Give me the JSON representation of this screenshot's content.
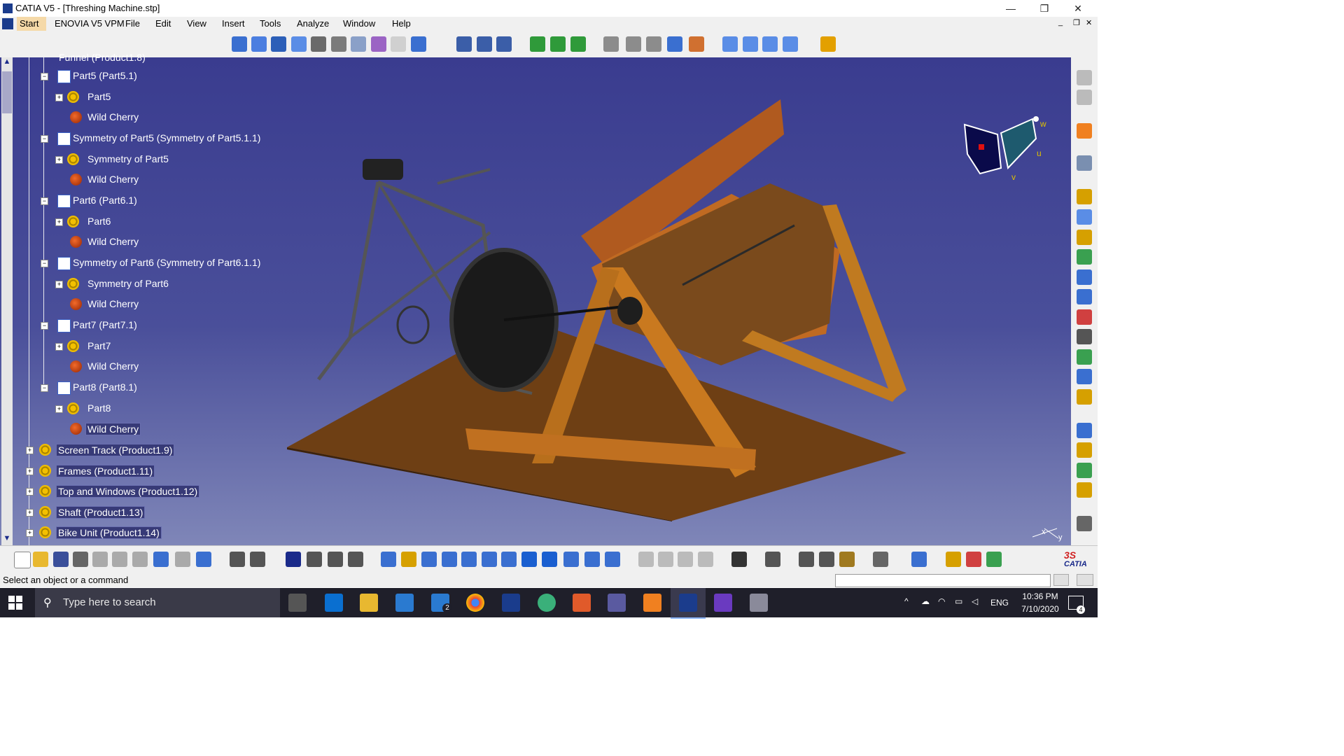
{
  "window": {
    "title": "CATIA V5 - [Threshing Machine.stp]",
    "minimize_glyph": "—",
    "restore_glyph": "❐",
    "close_glyph": "✕",
    "doc_minimize_glyph": "_",
    "doc_restore_glyph": "❐",
    "doc_close_glyph": "✕"
  },
  "menu": {
    "items": [
      "Start",
      "ENOVIA V5 VPM",
      "File",
      "Edit",
      "View",
      "Insert",
      "Tools",
      "Analyze",
      "Window",
      "Help"
    ]
  },
  "tree": {
    "partial_top": "Funnel (Product1.8)",
    "nodes": [
      {
        "label": "Part5 (Part5.1)",
        "level": 1,
        "kind": "product"
      },
      {
        "label": "Part5",
        "level": 2,
        "kind": "part"
      },
      {
        "label": "Wild Cherry",
        "level": 2,
        "kind": "material"
      },
      {
        "label": "Symmetry of Part5 (Symmetry of Part5.1.1)",
        "level": 1,
        "kind": "product"
      },
      {
        "label": "Symmetry of Part5",
        "level": 2,
        "kind": "part"
      },
      {
        "label": "Wild Cherry",
        "level": 2,
        "kind": "material"
      },
      {
        "label": "Part6 (Part6.1)",
        "level": 1,
        "kind": "product"
      },
      {
        "label": "Part6",
        "level": 2,
        "kind": "part"
      },
      {
        "label": "Wild Cherry",
        "level": 2,
        "kind": "material"
      },
      {
        "label": "Symmetry of Part6 (Symmetry of Part6.1.1)",
        "level": 1,
        "kind": "product"
      },
      {
        "label": "Symmetry of Part6",
        "level": 2,
        "kind": "part"
      },
      {
        "label": "Wild Cherry",
        "level": 2,
        "kind": "material"
      },
      {
        "label": "Part7 (Part7.1)",
        "level": 1,
        "kind": "product"
      },
      {
        "label": "Part7",
        "level": 2,
        "kind": "part"
      },
      {
        "label": "Wild Cherry",
        "level": 2,
        "kind": "material"
      },
      {
        "label": "Part8 (Part8.1)",
        "level": 1,
        "kind": "product"
      },
      {
        "label": "Part8",
        "level": 2,
        "kind": "part"
      },
      {
        "label": "Wild Cherry",
        "level": 2,
        "kind": "material"
      },
      {
        "label": "Screen Track (Product1.9)",
        "level": 0,
        "kind": "assembly"
      },
      {
        "label": "Frames (Product1.11)",
        "level": 0,
        "kind": "assembly"
      },
      {
        "label": "Top and Windows (Product1.12)",
        "level": 0,
        "kind": "assembly"
      },
      {
        "label": "Shaft (Product1.13)",
        "level": 0,
        "kind": "assembly"
      },
      {
        "label": "Bike Unit (Product1.14)",
        "level": 0,
        "kind": "assembly"
      }
    ]
  },
  "compass": {
    "axis_u": "u",
    "axis_v": "v",
    "axis_w": "w"
  },
  "axis_triad": {
    "x": "x",
    "y": "y"
  },
  "status": {
    "message": "Select an object or a command",
    "command_input": ""
  },
  "brand": {
    "logo_text": "CATIA"
  },
  "taskbar": {
    "search_placeholder": "Type here to search",
    "time": "10:36 PM",
    "date": "7/10/2020",
    "language": "ENG",
    "mail_badge": "2",
    "notification_badge": "4"
  },
  "colors": {
    "viewport_bg_top": "#3a3c8f",
    "viewport_bg_bottom": "#7f86b8",
    "wood_dark": "#6e3f14",
    "wood_light": "#c9791f",
    "start_menu_highlight": "#f5d9a8"
  }
}
